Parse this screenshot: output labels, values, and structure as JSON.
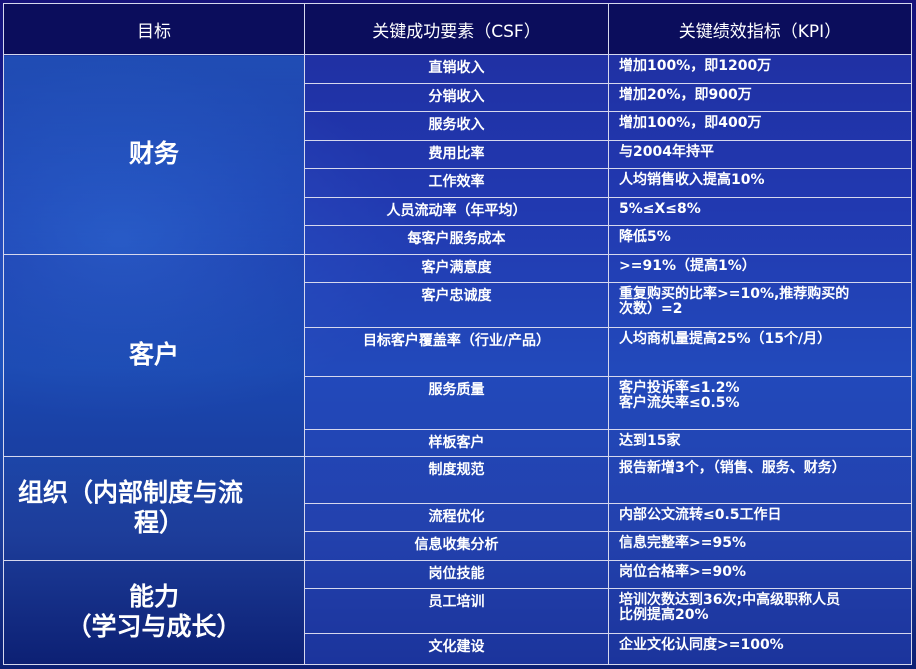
{
  "header": {
    "goal": "目标",
    "csf": "关键成功要素（CSF）",
    "kpi": "关键绩效指标（KPI）"
  },
  "groups": [
    {
      "goal": [
        "财务"
      ],
      "rows": [
        {
          "csf": "直销收入",
          "kpi": [
            "增加100%，即1200万"
          ]
        },
        {
          "csf": "分销收入",
          "kpi": [
            "增加20%，即900万"
          ]
        },
        {
          "csf": "服务收入",
          "kpi": [
            "增加100%，即400万"
          ]
        },
        {
          "csf": "费用比率",
          "kpi": [
            "与2004年持平"
          ]
        },
        {
          "csf": "工作效率",
          "kpi": [
            "人均销售收入提高10%"
          ]
        },
        {
          "csf": "人员流动率（年平均）",
          "kpi": [
            "5%≤X≤8%"
          ]
        },
        {
          "csf": "每客户服务成本",
          "kpi": [
            "降低5%"
          ]
        }
      ]
    },
    {
      "goal": [
        "客户"
      ],
      "rows": [
        {
          "csf": "客户满意度",
          "kpi": [
            ">=91%（提高1%）"
          ]
        },
        {
          "csf": "客户忠诚度",
          "kpi": [
            "重复购买的比率>=10%,推荐购买的",
            "次数）=2"
          ]
        },
        {
          "csf": "目标客户覆盖率（行业/产品）",
          "kpi": [
            "人均商机量提高25%（15个/月）"
          ]
        },
        {
          "csf": "服务质量",
          "kpi": [
            "客户投诉率≤1.2%",
            "客户流失率≤0.5%"
          ]
        },
        {
          "csf": "样板客户",
          "kpi": [
            "达到15家"
          ]
        }
      ]
    },
    {
      "goal": [
        "组织（内部制度与流",
        "程）"
      ],
      "rows": [
        {
          "csf": "制度规范",
          "kpi": [
            "报告新增3个，（销售、服务、财务）"
          ]
        },
        {
          "csf": "流程优化",
          "kpi": [
            "内部公文流转≤0.5工作日"
          ]
        },
        {
          "csf": "信息收集分析",
          "kpi": [
            "信息完整率>=95%"
          ]
        }
      ]
    },
    {
      "goal": [
        "能力",
        "（学习与成长）"
      ],
      "rows": [
        {
          "csf": "岗位技能",
          "kpi": [
            "岗位合格率>=90%"
          ]
        },
        {
          "csf": "员工培训",
          "kpi": [
            "培训次数达到36次;中高级职称人员",
            "比例提高20%"
          ]
        },
        {
          "csf": "文化建设",
          "kpi": [
            "企业文化认同度>=100%"
          ]
        }
      ]
    }
  ]
}
